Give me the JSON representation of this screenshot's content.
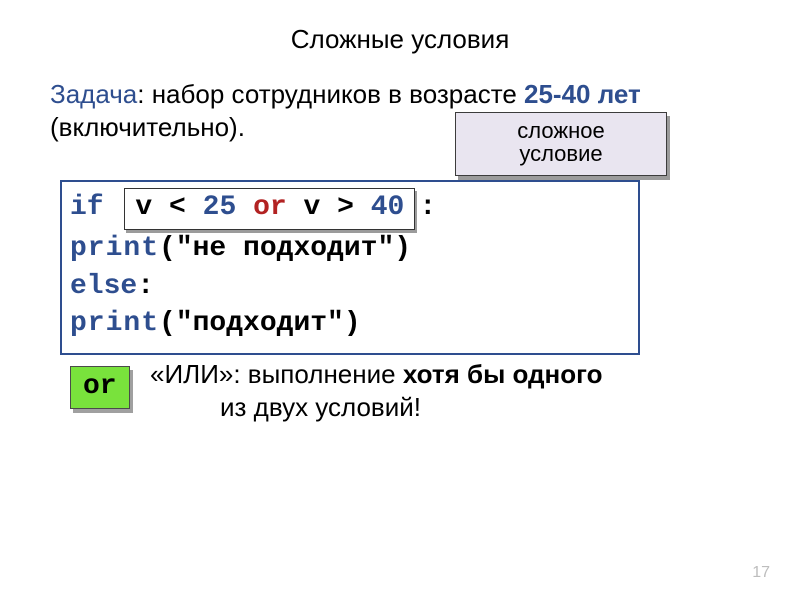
{
  "title": "Сложные условия",
  "task": {
    "label": "Задача",
    "colon": ": ",
    "body1": "набор сотрудников в возрасте ",
    "range": "25-40 лет",
    "body2": " (включительно).",
    "hidden_tail": ""
  },
  "callout": {
    "line1": "сложное",
    "line2": "условие"
  },
  "code": {
    "if_kw": "if",
    "cond_v1": "v",
    "cond_lt": " < ",
    "cond_25": "25",
    "cond_or": " or ",
    "cond_v2": "v",
    "cond_gt": " > ",
    "cond_40": "40",
    "if_colon": ":",
    "indent": "  ",
    "print1_fn": "print",
    "print1_open": "(",
    "print1_str": "\"не подходит\"",
    "print1_close": ")",
    "else_kw": "else",
    "else_colon": ":",
    "print2_fn": "print",
    "print2_open": "(",
    "print2_str": "\"подходит\"",
    "print2_close": ")"
  },
  "or_badge": "or",
  "explain": {
    "l1a": "«ИЛИ»: выполнение ",
    "l1b_bold": "хотя бы одного",
    "l2": "из двух условий!"
  },
  "page_number": "17",
  "chart_data": null
}
